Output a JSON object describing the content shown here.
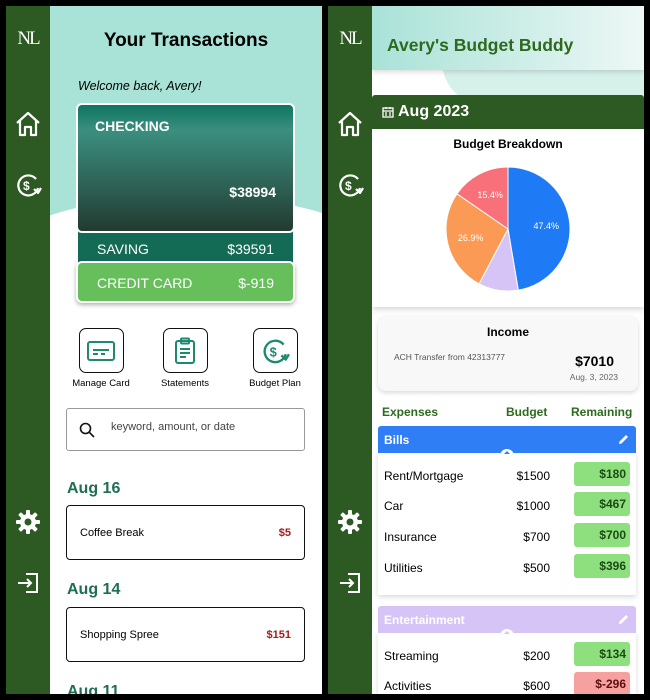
{
  "colors": {
    "rail": "#2d5a23",
    "teal": "#a9e2d7",
    "bills": "#2f7ef5",
    "entertainment": "#d6c4f6",
    "positive": "#8ee07e",
    "negative": "#f7a0a0"
  },
  "logo": "NL",
  "rail_icons": [
    "home-icon",
    "budget-cycle-icon",
    "settings-gear-icon",
    "logout-icon"
  ],
  "transactions": {
    "title": "Your Transactions",
    "welcome": "Welcome back, Avery!",
    "accounts": [
      {
        "name": "CHECKING",
        "amount": "$38994"
      },
      {
        "name": "SAVING",
        "amount": "$39591"
      },
      {
        "name": "CREDIT CARD",
        "amount": "$-919"
      }
    ],
    "quick_actions": [
      {
        "label": "Manage Card",
        "icon": "card-icon"
      },
      {
        "label": "Statements",
        "icon": "clipboard-icon"
      },
      {
        "label": "Budget Plan",
        "icon": "budget-cycle-icon"
      }
    ],
    "search_placeholder": "keyword, amount, or date",
    "groups": [
      {
        "date": "Aug 16",
        "name": "Coffee Break",
        "amount": "$5"
      },
      {
        "date": "Aug 14",
        "name": "Shopping Spree",
        "amount": "$151"
      },
      {
        "date": "Aug 11"
      }
    ]
  },
  "budget": {
    "title": "Avery's Budget Buddy",
    "month": "Aug 2023",
    "chart_title": "Budget Breakdown",
    "income": {
      "title": "Income",
      "desc": "ACH Transfer from 42313777",
      "amount": "$7010",
      "date": "Aug. 3, 2023"
    },
    "headers": {
      "expenses": "Expenses",
      "budget": "Budget",
      "remaining": "Remaining"
    },
    "categories": [
      {
        "name": "Bills",
        "items": [
          {
            "name": "Rent/Mortgage",
            "budget": "$1500",
            "remaining": "$180",
            "negative": false
          },
          {
            "name": "Car",
            "budget": "$1000",
            "remaining": "$467",
            "negative": false
          },
          {
            "name": "Insurance",
            "budget": "$700",
            "remaining": "$700",
            "negative": false
          },
          {
            "name": "Utilities",
            "budget": "$500",
            "remaining": "$396",
            "negative": false
          }
        ]
      },
      {
        "name": "Entertainment",
        "items": [
          {
            "name": "Streaming",
            "budget": "$200",
            "remaining": "$134",
            "negative": false
          },
          {
            "name": "Activities",
            "budget": "$600",
            "remaining": "$-296",
            "negative": true
          }
        ]
      }
    ]
  },
  "chart_data": {
    "type": "pie",
    "title": "Budget Breakdown",
    "slices": [
      {
        "value": 47.4,
        "label": "47.4%",
        "color": "#1f7af5"
      },
      {
        "value": 10.4,
        "label": "",
        "color": "#d6c4f6"
      },
      {
        "value": 26.9,
        "label": "26.9%",
        "color": "#fb9a55"
      },
      {
        "value": 15.4,
        "label": "15.4%",
        "color": "#f7707a"
      }
    ]
  }
}
